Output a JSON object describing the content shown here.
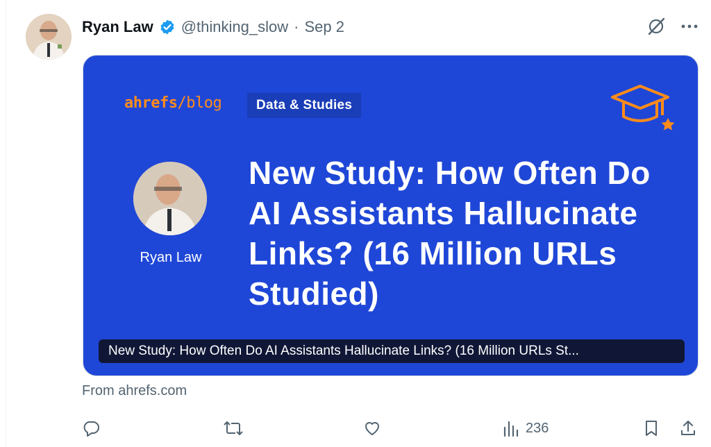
{
  "tweet": {
    "author_name": "Ryan Law",
    "handle": "@thinking_slow",
    "separator": "·",
    "date": "Sep 2",
    "source": "From ahrefs.com"
  },
  "card": {
    "brand_main": "ahrefs",
    "brand_slash": "/",
    "brand_sub": "blog",
    "category": "Data & Studies",
    "author_name": "Ryan Law",
    "headline": "New Study: How Often Do AI Assistants Hallucinate Links? (16 Million URLs Studied)",
    "link_title": "New Study: How Often Do AI Assistants Hallucinate Links? (16 Million URLs St..."
  },
  "actions": {
    "reply_icon": "reply-icon",
    "retweet_icon": "retweet-icon",
    "like_icon": "heart-icon",
    "views_icon": "views-icon",
    "views_count": "236",
    "bookmark_icon": "bookmark-icon",
    "share_icon": "share-icon"
  },
  "colors": {
    "card_bg": "#1f47d7",
    "brand_orange": "#ff8c1a",
    "verified_blue": "#1d9bf0",
    "muted_text": "#536471"
  }
}
